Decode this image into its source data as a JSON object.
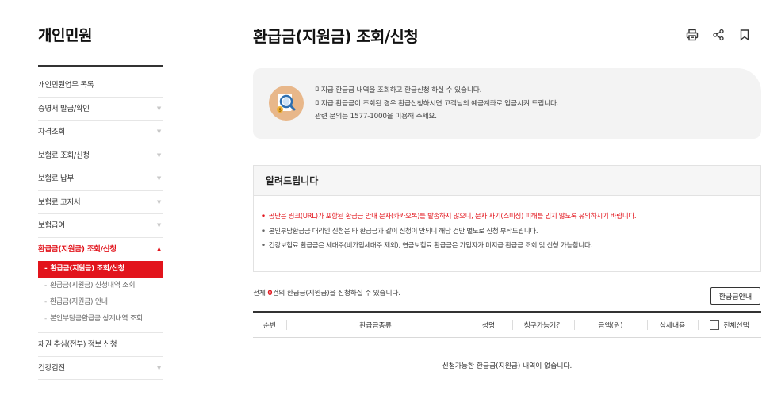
{
  "sidebar": {
    "title": "개인민원",
    "items": [
      {
        "label": "개인민원업무 목록",
        "arrow": ""
      },
      {
        "label": "증명서 발급/확인",
        "arrow": "▼"
      },
      {
        "label": "자격조회",
        "arrow": "▼"
      },
      {
        "label": "보험료 조회/신청",
        "arrow": "▼"
      },
      {
        "label": "보험료 납부",
        "arrow": "▼"
      },
      {
        "label": "보험료 고지서",
        "arrow": "▼"
      },
      {
        "label": "보험급여",
        "arrow": "▼"
      },
      {
        "label": "환급금(지원금) 조회/신청",
        "arrow": "▲"
      }
    ],
    "sub_items": [
      {
        "label": "환급금(지원금) 조회/신청",
        "dash": "-"
      },
      {
        "label": "환급금(지원금) 신청내역 조회",
        "dash": "-"
      },
      {
        "label": "환급금(지원금) 안내",
        "dash": "-"
      },
      {
        "label": "본인부담금환급금 상계내역 조회",
        "dash": "-"
      }
    ],
    "items_after": [
      {
        "label": "채권 추심(전부) 정보 신청",
        "arrow": ""
      },
      {
        "label": "건강검진",
        "arrow": "▼"
      }
    ]
  },
  "header": {
    "title": "환급금(지원금) 조회/신청",
    "icons": [
      "print-icon",
      "share-icon",
      "bookmark-icon"
    ]
  },
  "info": {
    "lines": [
      "미지급 환급금 내역을 조회하고 환급신청 하실 수 있습니다.",
      "미지급 환급금이 조회된 경우 환급신청하시면 고객님의 예금계좌로 입금시켜 드립니다.",
      "관련 문의는 1577-1000을 이용해 주세요."
    ]
  },
  "notice": {
    "title": "알려드립니다",
    "items": [
      "공단은 링크(URL)가 포함된 환급금 안내 문자(카카오톡)를 발송하지 않으니, 문자 사기(스미싱) 피해를 입지 않도록 유의하시기 바랍니다.",
      "본인부담환급금 대리인 신청은 타 환급금과 같이 신청이 안되니 해당 건만 별도로 신청 부탁드립니다.",
      "건강보험료 환급금은 세대주(비가입세대주 제외), 연금보험료 환급금은 가입자가 미지급 환급금 조회 및 신청 가능합니다."
    ],
    "bullet": "•"
  },
  "count": {
    "prefix": "전체 ",
    "num": "0",
    "suffix": "건의 환급금(지원금)을 신청하실 수 있습니다."
  },
  "guide_button": "환급금안내",
  "table": {
    "headers": [
      "순번",
      "환급금종류",
      "성명",
      "청구가능기간",
      "금액(원)",
      "상세내용",
      "전체선택"
    ],
    "empty_message": "신청가능한 환급금(지원금) 내역이 없습니다."
  },
  "colors": {
    "accent": "#e2141c"
  }
}
